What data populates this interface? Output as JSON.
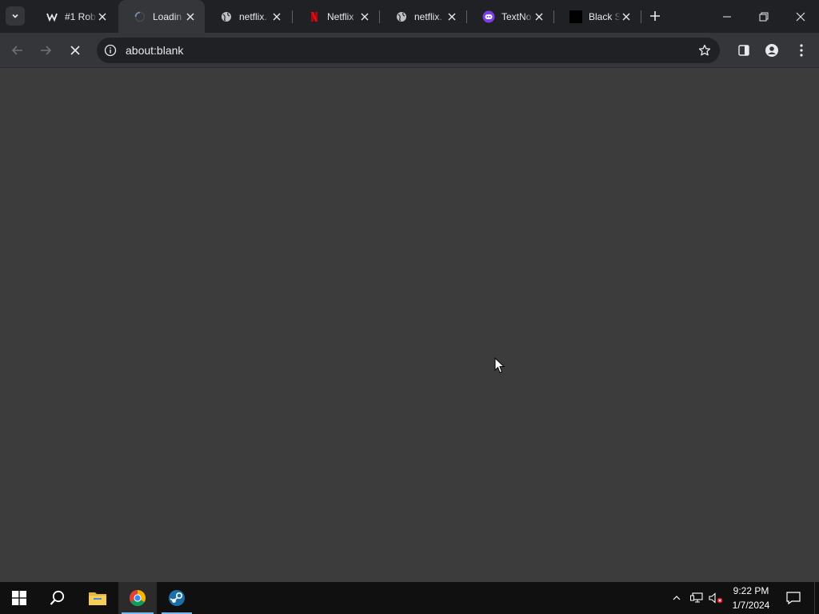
{
  "browser": {
    "tabs": [
      {
        "title": "#1 Rob",
        "favicon": "brand-w-icon"
      },
      {
        "title": "Loadin",
        "favicon": "loading-spinner-icon",
        "active": true
      },
      {
        "title": "netflix.",
        "favicon": "globe-icon"
      },
      {
        "title": "Netflix",
        "favicon": "netflix-icon"
      },
      {
        "title": "netflix.",
        "favicon": "globe-icon"
      },
      {
        "title": "TextNo",
        "favicon": "textnow-icon"
      },
      {
        "title": "Black S",
        "favicon": "black-square-icon"
      }
    ],
    "address_bar": {
      "url": "about:blank"
    }
  },
  "taskbar": {
    "pinned": [
      "windows-start-icon",
      "search-icon",
      "file-explorer-icon",
      "chrome-icon",
      "steam-icon"
    ],
    "clock": {
      "time": "9:22 PM",
      "date": "1/7/2024"
    }
  },
  "colors": {
    "tabstrip_bg": "#202124",
    "toolbar_bg": "#35363a",
    "content_bg": "#3c3c3c",
    "taskbar_bg": "#101010",
    "taskbar_active_accent": "#76b9ed"
  }
}
